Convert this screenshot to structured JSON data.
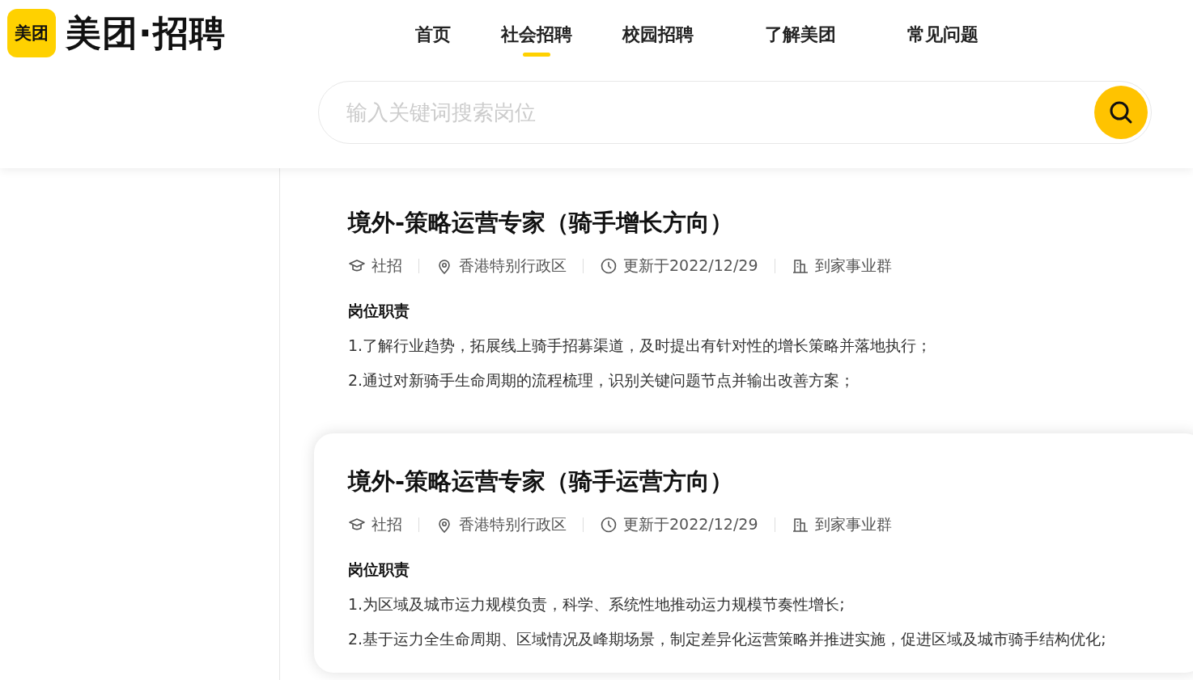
{
  "logo": {
    "badge": "美团",
    "text": "美团·招聘"
  },
  "nav": [
    {
      "label": "首页",
      "selected": false
    },
    {
      "label": "社会招聘",
      "selected": true
    },
    {
      "label": "校园招聘",
      "selected": false
    },
    {
      "label": "了解美团",
      "selected": false
    },
    {
      "label": "常见问题",
      "selected": false
    }
  ],
  "search": {
    "placeholder": "输入关键词搜索岗位"
  },
  "jobs": [
    {
      "title": "境外-策略运营专家（骑手增长方向）",
      "highlighted": false,
      "meta": [
        {
          "kind": "type",
          "text": "社招"
        },
        {
          "kind": "location",
          "text": "香港特别行政区"
        },
        {
          "kind": "updated",
          "text": "更新于2022/12/29"
        },
        {
          "kind": "department",
          "text": "到家事业群"
        }
      ],
      "section": "岗位职责",
      "duties": [
        "1.了解行业趋势，拓展线上骑手招募渠道，及时提出有针对性的增长策略并落地执行；",
        "2.通过对新骑手生命周期的流程梳理，识别关键问题节点并输出改善方案；"
      ]
    },
    {
      "title": "境外-策略运营专家（骑手运营方向）",
      "highlighted": true,
      "meta": [
        {
          "kind": "type",
          "text": "社招"
        },
        {
          "kind": "location",
          "text": "香港特别行政区"
        },
        {
          "kind": "updated",
          "text": "更新于2022/12/29"
        },
        {
          "kind": "department",
          "text": "到家事业群"
        }
      ],
      "section": "岗位职责",
      "duties": [
        "1.为区域及城市运力规模负责，科学、系统性地推动运力规模节奏性增长;",
        "2.基于运力全生命周期、区域情况及峰期场景，制定差异化运营策略并推进实施，促进区域及城市骑手结构优化;"
      ]
    }
  ]
}
